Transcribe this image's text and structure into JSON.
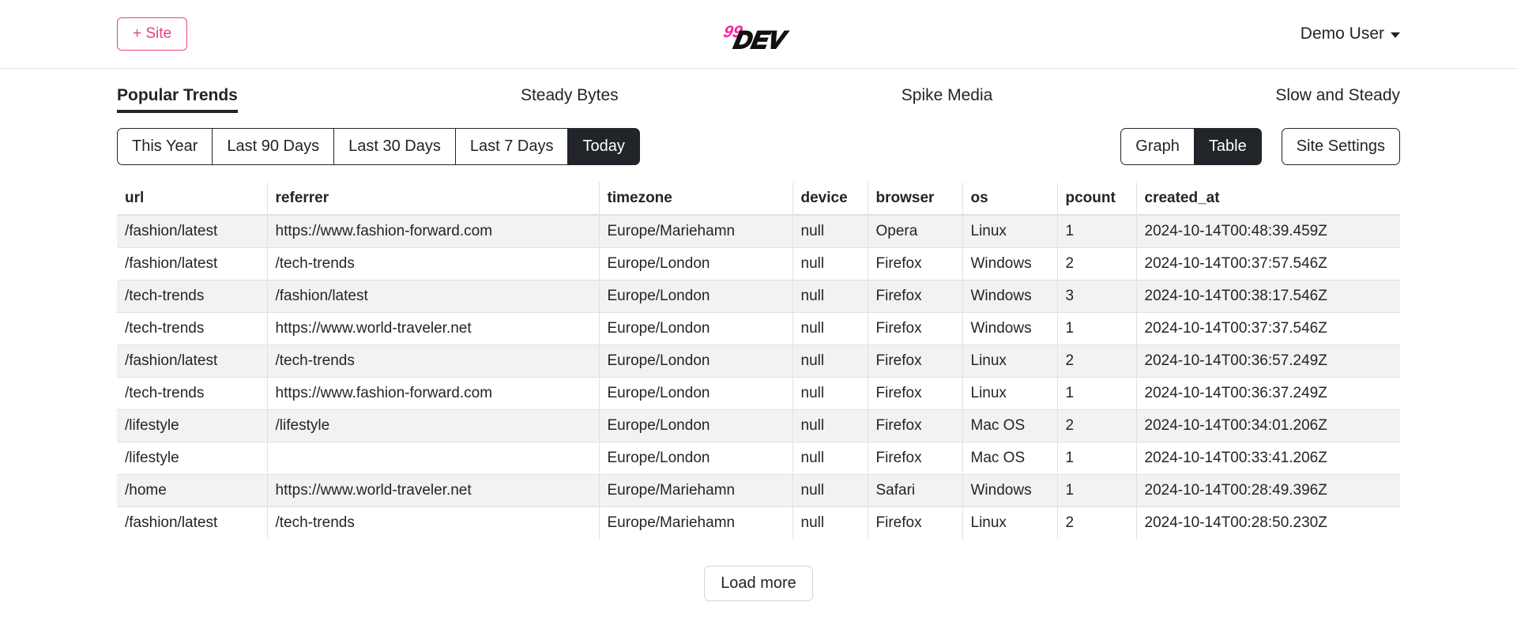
{
  "header": {
    "add_site_label": "+ Site",
    "logo": {
      "prefix": "99",
      "name": "DEV",
      "prefix_color": "#ff1f9c",
      "name_color": "#111111"
    },
    "user": {
      "label": "Demo User",
      "caret_icon": "chevron-down-icon"
    }
  },
  "site_tabs": [
    {
      "label": "Popular Trends",
      "active": true
    },
    {
      "label": "Steady Bytes",
      "active": false
    },
    {
      "label": "Spike Media",
      "active": false
    },
    {
      "label": "Slow and Steady",
      "active": false
    }
  ],
  "controls": {
    "range_buttons": [
      {
        "label": "This Year",
        "active": false
      },
      {
        "label": "Last 90 Days",
        "active": false
      },
      {
        "label": "Last 30 Days",
        "active": false
      },
      {
        "label": "Last 7 Days",
        "active": false
      },
      {
        "label": "Today",
        "active": true
      }
    ],
    "view_buttons": [
      {
        "label": "Graph",
        "active": false
      },
      {
        "label": "Table",
        "active": true
      }
    ],
    "site_settings_label": "Site Settings"
  },
  "table": {
    "columns": [
      "url",
      "referrer",
      "timezone",
      "device",
      "browser",
      "os",
      "pcount",
      "created_at"
    ],
    "rows": [
      [
        "/fashion/latest",
        "https://www.fashion-forward.com",
        "Europe/Mariehamn",
        "null",
        "Opera",
        "Linux",
        "1",
        "2024-10-14T00:48:39.459Z"
      ],
      [
        "/fashion/latest",
        "/tech-trends",
        "Europe/London",
        "null",
        "Firefox",
        "Windows",
        "2",
        "2024-10-14T00:37:57.546Z"
      ],
      [
        "/tech-trends",
        "/fashion/latest",
        "Europe/London",
        "null",
        "Firefox",
        "Windows",
        "3",
        "2024-10-14T00:38:17.546Z"
      ],
      [
        "/tech-trends",
        "https://www.world-traveler.net",
        "Europe/London",
        "null",
        "Firefox",
        "Windows",
        "1",
        "2024-10-14T00:37:37.546Z"
      ],
      [
        "/fashion/latest",
        "/tech-trends",
        "Europe/London",
        "null",
        "Firefox",
        "Linux",
        "2",
        "2024-10-14T00:36:57.249Z"
      ],
      [
        "/tech-trends",
        "https://www.fashion-forward.com",
        "Europe/London",
        "null",
        "Firefox",
        "Linux",
        "1",
        "2024-10-14T00:36:37.249Z"
      ],
      [
        "/lifestyle",
        "/lifestyle",
        "Europe/London",
        "null",
        "Firefox",
        "Mac OS",
        "2",
        "2024-10-14T00:34:01.206Z"
      ],
      [
        "/lifestyle",
        "",
        "Europe/London",
        "null",
        "Firefox",
        "Mac OS",
        "1",
        "2024-10-14T00:33:41.206Z"
      ],
      [
        "/home",
        "https://www.world-traveler.net",
        "Europe/Mariehamn",
        "null",
        "Safari",
        "Windows",
        "1",
        "2024-10-14T00:28:49.396Z"
      ],
      [
        "/fashion/latest",
        "/tech-trends",
        "Europe/Mariehamn",
        "null",
        "Firefox",
        "Linux",
        "2",
        "2024-10-14T00:28:50.230Z"
      ]
    ]
  },
  "footer": {
    "load_more_label": "Load more"
  }
}
